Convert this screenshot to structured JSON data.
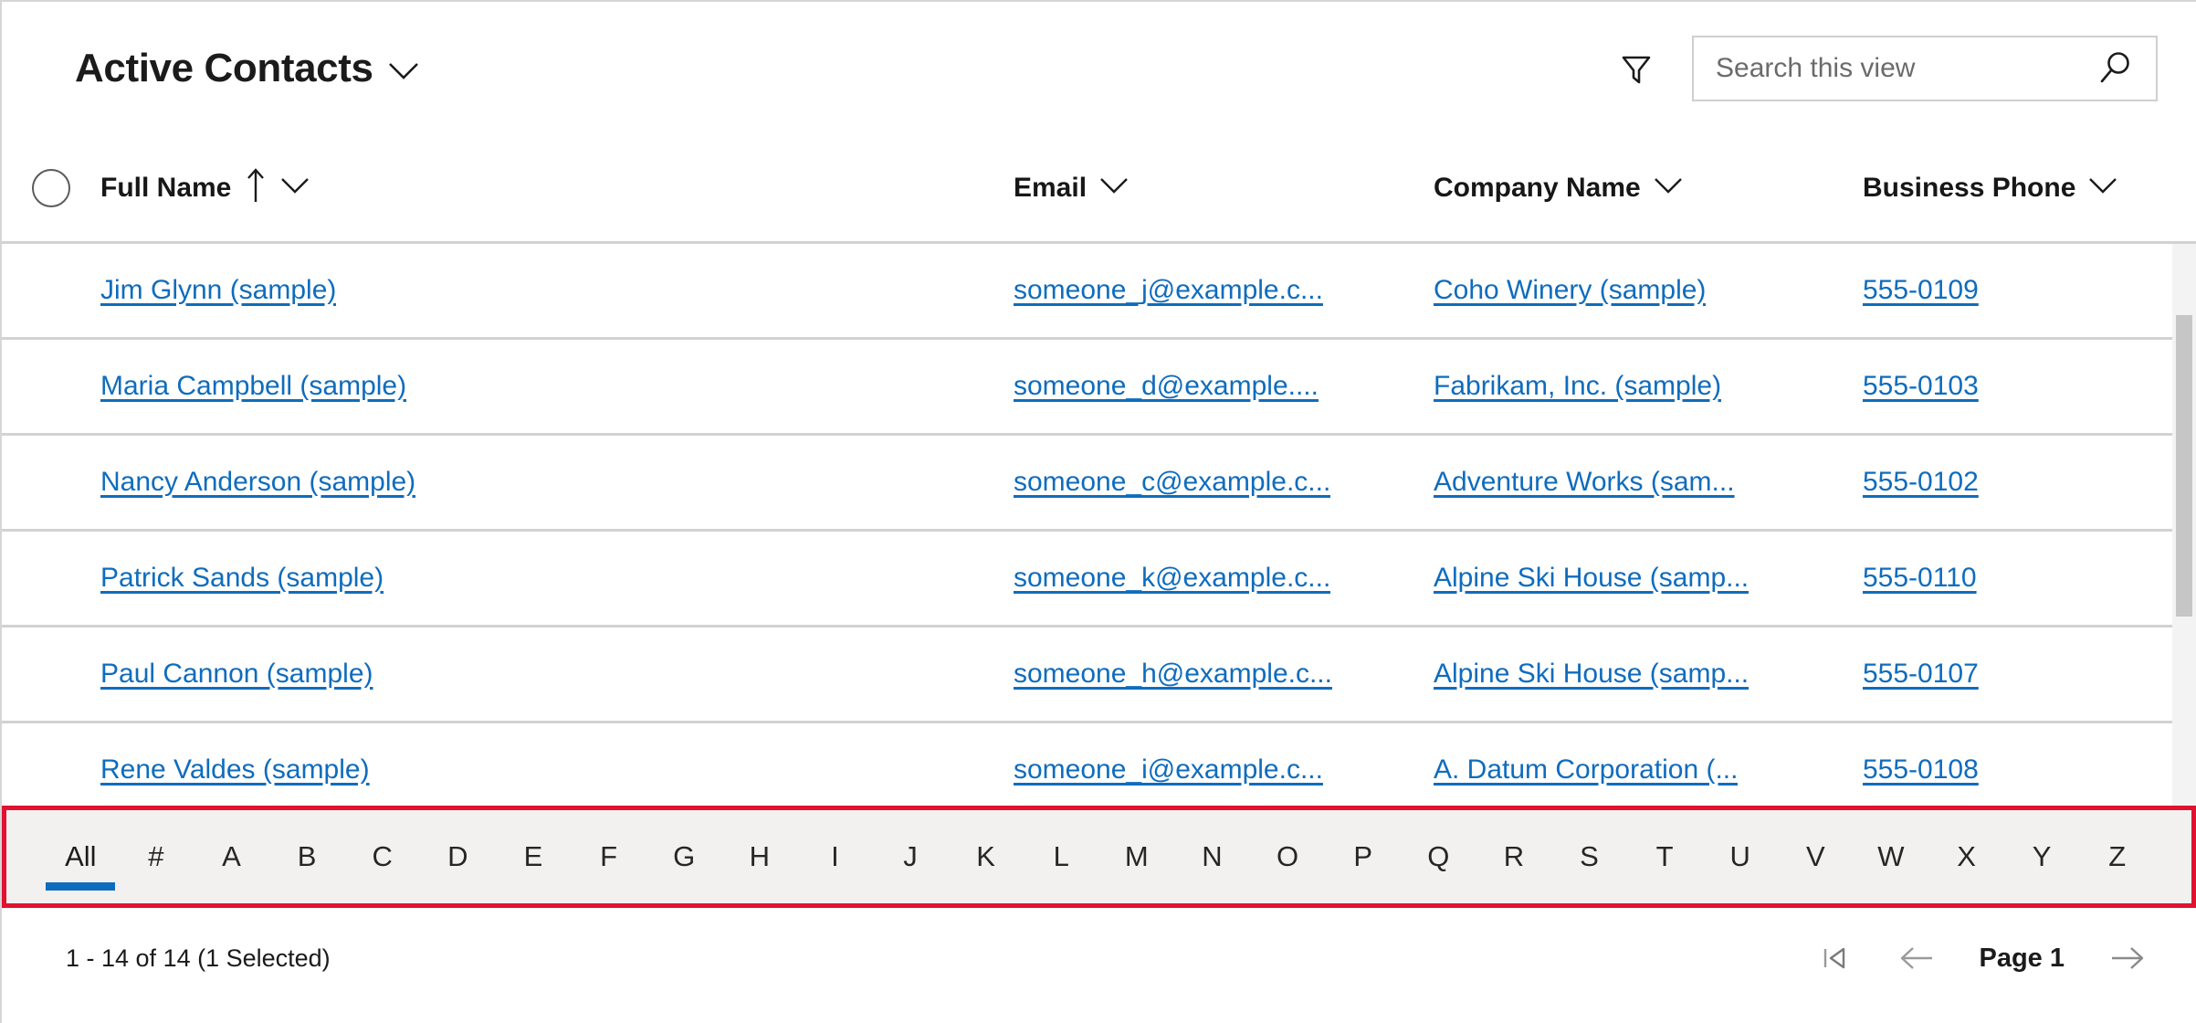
{
  "view": {
    "title": "Active Contacts",
    "chevron_icon": "chevron-down-icon"
  },
  "toolbar": {
    "filter_icon": "filter-funnel-icon",
    "search": {
      "placeholder": "Search this view",
      "value": "",
      "icon": "search-icon"
    }
  },
  "grid": {
    "select_all": "select-all-circle",
    "columns": [
      {
        "label": "Full Name",
        "sort": "ascending",
        "sort_icon": "sort-arrow-up-icon",
        "menu_icon": "chevron-down-icon"
      },
      {
        "label": "Email",
        "sort": "none",
        "menu_icon": "chevron-down-icon"
      },
      {
        "label": "Company Name",
        "sort": "none",
        "menu_icon": "chevron-down-icon"
      },
      {
        "label": "Business Phone",
        "sort": "none",
        "menu_icon": "chevron-down-icon"
      }
    ],
    "rows": [
      {
        "full_name": "Jim Glynn (sample)",
        "email": "someone_j@example.c...",
        "company": "Coho Winery (sample)",
        "phone": "555-0109"
      },
      {
        "full_name": "Maria Campbell (sample)",
        "email": "someone_d@example....",
        "company": "Fabrikam, Inc. (sample)",
        "phone": "555-0103"
      },
      {
        "full_name": "Nancy Anderson (sample)",
        "email": "someone_c@example.c...",
        "company": "Adventure Works (sam...",
        "phone": "555-0102"
      },
      {
        "full_name": "Patrick Sands (sample)",
        "email": "someone_k@example.c...",
        "company": "Alpine Ski House (samp...",
        "phone": "555-0110"
      },
      {
        "full_name": "Paul Cannon (sample)",
        "email": "someone_h@example.c...",
        "company": "Alpine Ski House (samp...",
        "phone": "555-0107"
      },
      {
        "full_name": "Rene Valdes (sample)",
        "email": "someone_i@example.c...",
        "company": "A. Datum Corporation (...",
        "phone": "555-0108"
      }
    ]
  },
  "alphabet_filter": {
    "highlighted": true,
    "highlight_color": "#e01230",
    "selected": "All",
    "items": [
      "All",
      "#",
      "A",
      "B",
      "C",
      "D",
      "E",
      "F",
      "G",
      "H",
      "I",
      "J",
      "K",
      "L",
      "M",
      "N",
      "O",
      "P",
      "Q",
      "R",
      "S",
      "T",
      "U",
      "V",
      "W",
      "X",
      "Y",
      "Z"
    ]
  },
  "status": {
    "record_count": "1 - 14 of 14 (1 Selected)",
    "pagination": {
      "first_icon": "first-page-icon",
      "prev_icon": "arrow-left-icon",
      "page_label": "Page 1",
      "next_icon": "arrow-right-icon"
    }
  },
  "colors": {
    "link": "#0f6cbd",
    "accent": "#0f6cbd",
    "highlight": "#e01230",
    "alpha_bar_bg": "#f2f1f0"
  }
}
